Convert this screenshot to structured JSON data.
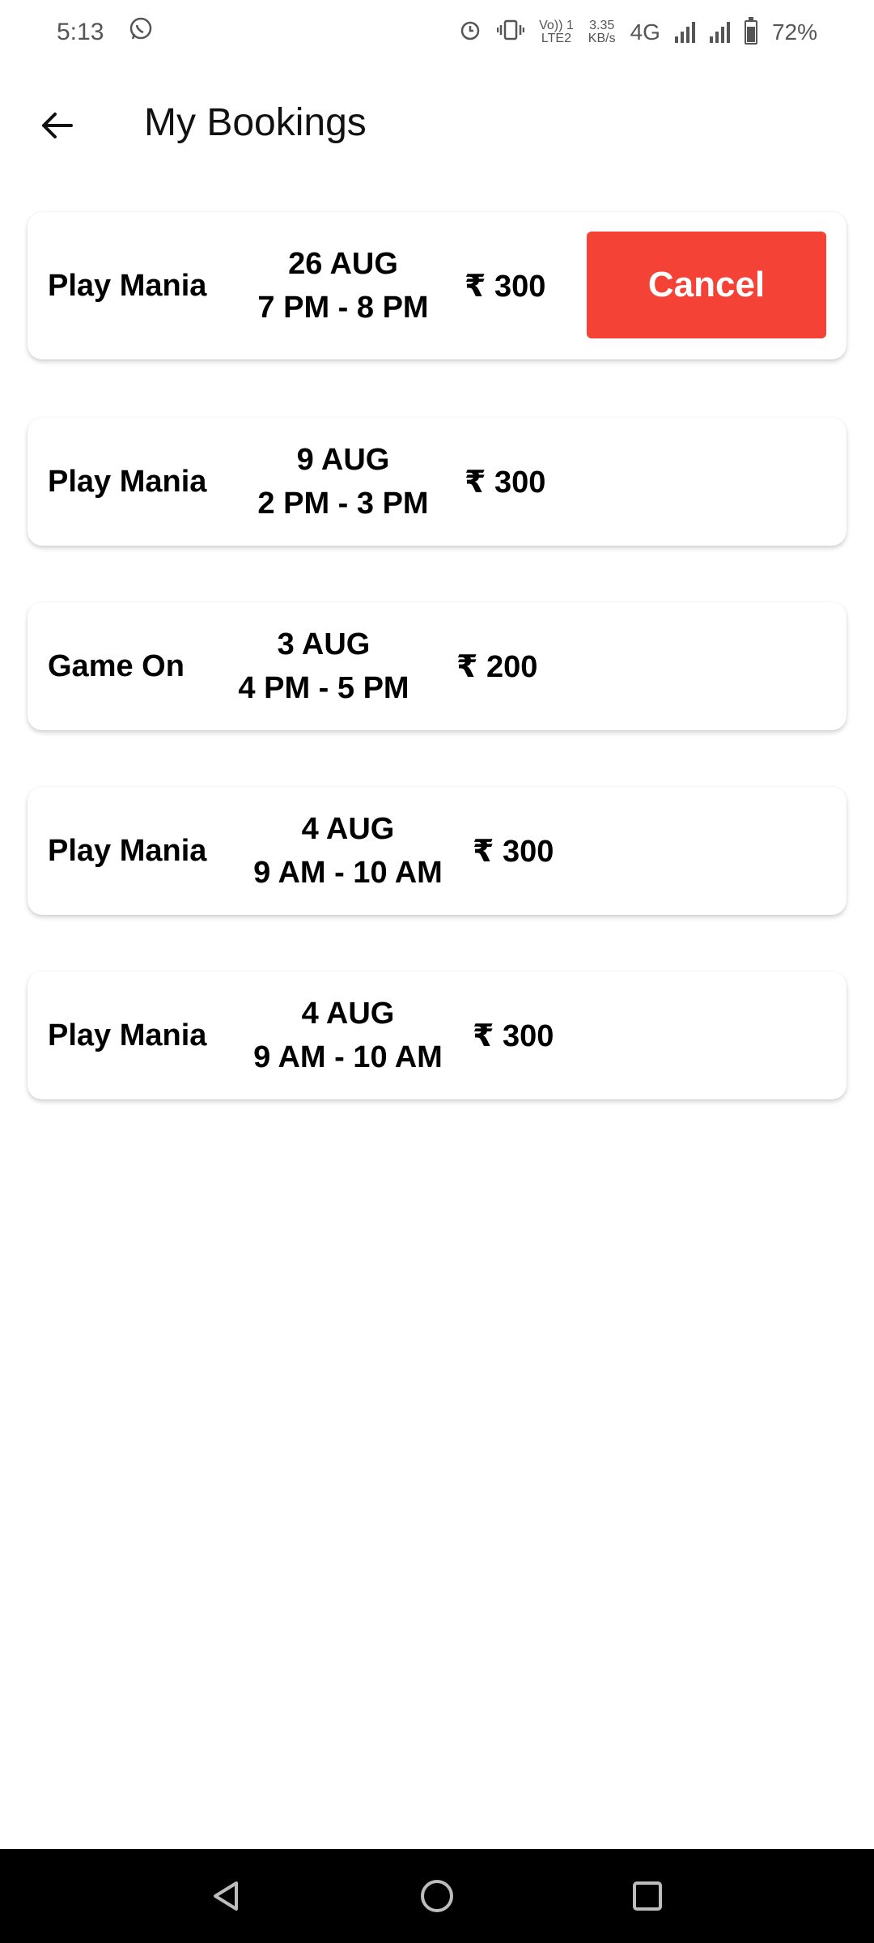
{
  "status_bar": {
    "time": "5:13",
    "net_line1": "3.35",
    "net_line2": "KB/s",
    "net_type": "4G",
    "volte_1": "Vo)) 1",
    "volte_2": "LTE2",
    "battery": "72%",
    "icons": [
      "whatsapp-icon",
      "alarm-icon",
      "vibrate-icon",
      "signal-icon",
      "battery-icon"
    ]
  },
  "header": {
    "title": "My Bookings",
    "back_icon": "arrow-left-icon"
  },
  "bookings": [
    {
      "venue": "Play Mania",
      "date": "26 AUG",
      "time": "7 PM - 8 PM",
      "price": "₹ 300",
      "action": "Cancel"
    },
    {
      "venue": "Play Mania",
      "date": "9 AUG",
      "time": "2 PM - 3 PM",
      "price": "₹ 300"
    },
    {
      "venue": "Game On",
      "date": "3 AUG",
      "time": "4 PM - 5 PM",
      "price": "₹ 200"
    },
    {
      "venue": "Play Mania",
      "date": "4 AUG",
      "time": "9 AM - 10 AM",
      "price": "₹ 300"
    },
    {
      "venue": "Play Mania",
      "date": "4 AUG",
      "time": "9 AM - 10 AM",
      "price": "₹ 300"
    }
  ],
  "colors": {
    "cancel_button": "#f44336",
    "nav_bar": "#000000",
    "background": "#ffffff"
  },
  "nav_bar": {
    "icons": [
      "back-triangle-icon",
      "home-circle-icon",
      "recents-square-icon"
    ]
  }
}
